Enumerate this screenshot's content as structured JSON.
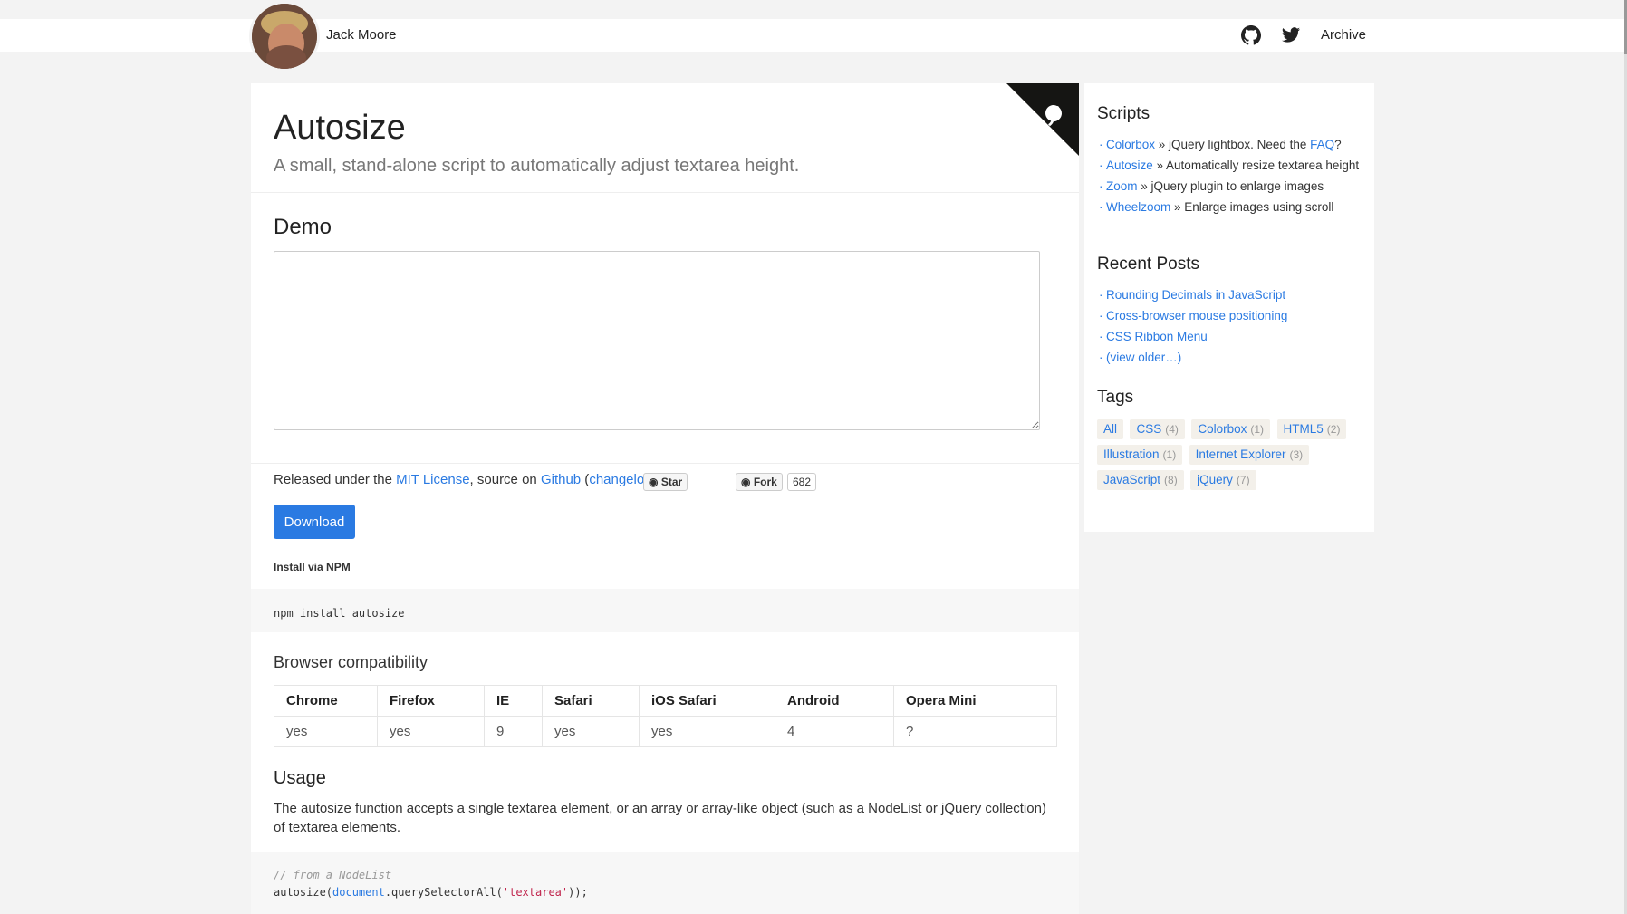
{
  "header": {
    "author": "Jack Moore",
    "icons": [
      "github-icon",
      "twitter-icon"
    ],
    "archive_label": "Archive"
  },
  "main": {
    "title": "Autosize",
    "subtitle": "A small, stand-alone script to automatically adjust textarea height.",
    "demo_heading": "Demo",
    "demo_textarea_value": "",
    "released_prefix": "Released under the ",
    "license_link": "MIT License",
    "source_text": ", source on ",
    "github_link": "Github",
    "changelog_open": " (",
    "changelog_link": "changelog",
    "changelog_close": ")",
    "star_label": "Star",
    "fork_label": "Fork",
    "fork_count": "682",
    "download_label": "Download",
    "npm_label": "Install via NPM",
    "npm_command": "npm install autosize",
    "compat_heading": "Browser compatibility",
    "compat_headers": [
      "Chrome",
      "Firefox",
      "IE",
      "Safari",
      "iOS Safari",
      "Android",
      "Opera Mini"
    ],
    "compat_values": [
      "yes",
      "yes",
      "9",
      "yes",
      "yes",
      "4",
      "?"
    ],
    "usage_heading": "Usage",
    "usage_text": "The autosize function accepts a single textarea element, or an array or array-like object (such as a NodeList or jQuery collection) of textarea elements.",
    "code_comment": "// from a NodeList",
    "code_fn": "autosize(",
    "code_obj": "document",
    "code_method": ".querySelectorAll(",
    "code_str": "'textarea'",
    "code_end": "));"
  },
  "sidebar": {
    "scripts_heading": "Scripts",
    "scripts": [
      {
        "link": "Colorbox",
        "sep": " » ",
        "desc": "jQuery lightbox. Need the ",
        "extra_link": "FAQ",
        "extra_after": "?"
      },
      {
        "link": "Autosize",
        "sep": " » ",
        "desc": "Automatically resize textarea height"
      },
      {
        "link": "Zoom",
        "sep": " » ",
        "desc": "jQuery plugin to enlarge images"
      },
      {
        "link": "Wheelzoom",
        "sep": " » ",
        "desc": "Enlarge images using scroll"
      }
    ],
    "recent_heading": "Recent Posts",
    "recent": [
      "Rounding Decimals in JavaScript",
      "Cross-browser mouse positioning",
      "CSS Ribbon Menu",
      "(view older…)"
    ],
    "tags_heading": "Tags",
    "tags": [
      {
        "name": "All",
        "count": ""
      },
      {
        "name": "CSS",
        "count": "(4)"
      },
      {
        "name": "Colorbox",
        "count": "(1)"
      },
      {
        "name": "HTML5",
        "count": "(2)"
      },
      {
        "name": "Illustration",
        "count": "(1)"
      },
      {
        "name": "Internet Explorer",
        "count": "(3)"
      },
      {
        "name": "JavaScript",
        "count": "(8)"
      },
      {
        "name": "jQuery",
        "count": "(7)"
      }
    ]
  },
  "colors": {
    "accent": "#2a7ae2",
    "page_bg": "#f3f3f3"
  }
}
